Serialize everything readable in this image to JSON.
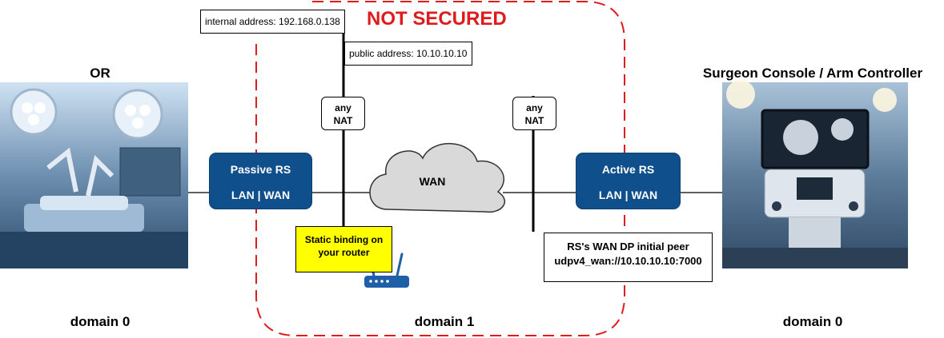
{
  "title": "NOT SECURED",
  "left_site": {
    "label": "OR",
    "domain": "domain 0"
  },
  "right_site": {
    "label": "Surgeon Console / Arm Controller",
    "domain": "domain 0"
  },
  "middle": {
    "domain": "domain 1",
    "cloud_label": "WAN"
  },
  "passive_rs": {
    "name": "Passive RS",
    "ports": "LAN | WAN"
  },
  "active_rs": {
    "name": "Active RS",
    "ports": "LAN | WAN"
  },
  "internal_address": "internal address: 192.168.0.138",
  "public_address": "public address: 10.10.10.10",
  "nat_left": {
    "line1": "any",
    "line2": "NAT"
  },
  "nat_right": {
    "line1": "any",
    "line2": "NAT"
  },
  "static_binding": {
    "line1": "Static binding on",
    "line2": "your router"
  },
  "peer_note": {
    "line1": "RS's WAN DP initial peer",
    "line2": "udpv4_wan://10.10.10.10:7000"
  },
  "colors": {
    "rs_blue": "#0f4f8c",
    "danger_red": "#e01b1b",
    "note_yellow": "#ffff00",
    "cloud_gray": "#d9d9d9"
  },
  "icons": [
    "operating-room-photo",
    "surgeon-console-photo",
    "router-icon",
    "cloud-shape"
  ]
}
